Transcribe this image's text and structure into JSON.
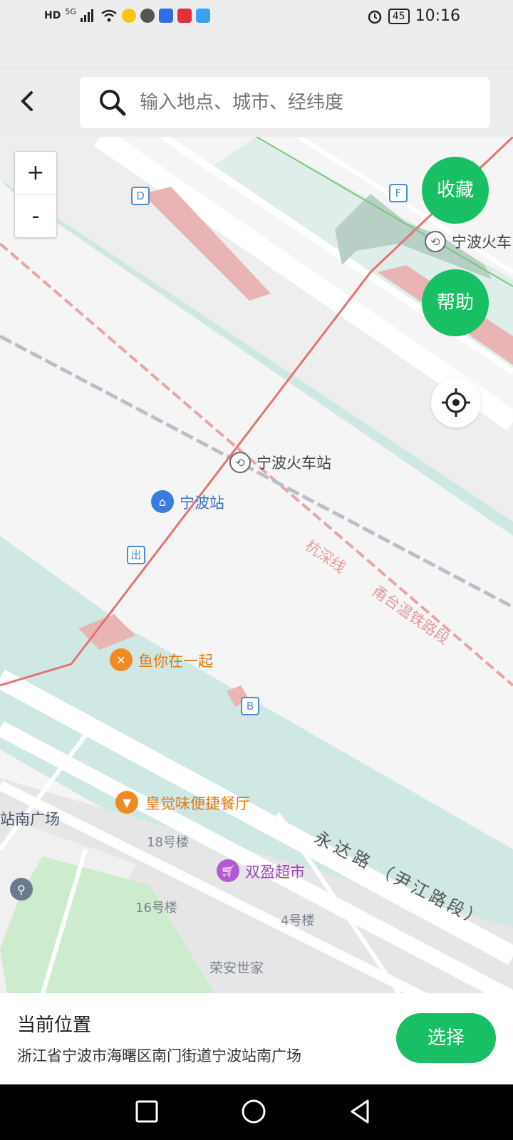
{
  "status_bar": {
    "left_labels": [
      "HD",
      "5G"
    ],
    "time": "10:16",
    "battery": "45",
    "icons": [
      "signal-icon",
      "wifi-icon",
      "app-icon",
      "wechat-icon",
      "app-icon",
      "app-icon",
      "app-icon",
      "alarm-icon",
      "battery-icon"
    ]
  },
  "search": {
    "placeholder": "输入地点、城市、经纬度",
    "back_icon": "chevron-left-icon",
    "search_icon": "search-icon"
  },
  "map": {
    "zoom_in": "+",
    "zoom_out": "-",
    "favorite_button": "收藏",
    "help_button": "帮助",
    "locate_icon": "locate-icon",
    "labels": {
      "station_transfer_top": "宁波火车",
      "station_transfer_center": "宁波火车站",
      "ningbo_station": "宁波站",
      "railway_name": "杭深线",
      "railway_section": "甬台温铁路段",
      "restaurant_fish": "鱼你在一起",
      "restaurant_huangjuewei": "皇觉味便捷餐厅",
      "supermarket": "双盈超市",
      "building_18": "18号楼",
      "building_16": "16号楼",
      "building_4": "4号楼",
      "rongan": "荣安世家",
      "south_square": "站南广场",
      "road_name": "永达路",
      "road_section": "（尹江路段）",
      "exit_badge": "出",
      "badge_b": "B",
      "badge_d": "D",
      "badge_f": "F"
    },
    "colors": {
      "water": "#cfe8e4",
      "road": "#ffffff",
      "rail_red": "#e57373",
      "green_park": "#cdeccd",
      "accent": "#19bf64"
    }
  },
  "bottom_panel": {
    "title": "当前位置",
    "address": "浙江省宁波市海曙区南门街道宁波站南广场",
    "select_button": "选择"
  },
  "nav_bar": {
    "items": [
      "recent-apps-icon",
      "home-icon",
      "back-icon"
    ]
  }
}
